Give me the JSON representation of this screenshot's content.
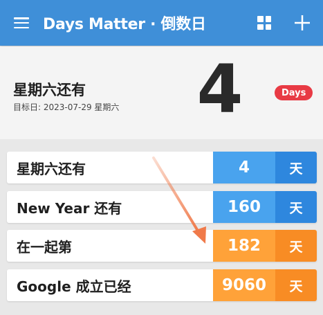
{
  "app_bar": {
    "title": "Days Matter · 倒数日",
    "menu_icon": "menu-icon",
    "grid_icon": "grid-icon",
    "add_icon": "add-icon",
    "background": "#3f8fd8"
  },
  "hero": {
    "title": "星期六还有",
    "subtitle": "目标日: 2023-07-29 星期六",
    "count": "4",
    "badge": "Days",
    "badge_color": "#e83a44"
  },
  "events": [
    {
      "label": "星期六还有",
      "count": "4",
      "unit": "天",
      "color": "blue"
    },
    {
      "label": "New Year 还有",
      "count": "160",
      "unit": "天",
      "color": "blue"
    },
    {
      "label": "在一起第",
      "count": "182",
      "unit": "天",
      "color": "orange"
    },
    {
      "label": "Google 成立已经",
      "count": "9060",
      "unit": "天",
      "color": "orange"
    }
  ],
  "colors": {
    "future_count": "#49a3ee",
    "future_unit": "#2e87de",
    "past_count": "#ffa239",
    "past_unit": "#f88c24",
    "annotation_arrow": "#f07a4a"
  }
}
